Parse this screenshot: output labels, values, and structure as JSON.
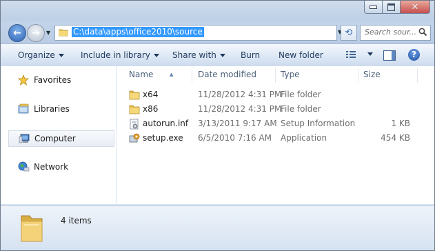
{
  "window": {
    "minimize_icon": "minimize-icon",
    "maximize_icon": "maximize-icon",
    "close_icon": "close-icon"
  },
  "address_bar": {
    "path": "C:\\data\\apps\\office2010\\source",
    "selected": true
  },
  "search": {
    "placeholder": "Search sour..."
  },
  "toolbar": {
    "organize": "Organize",
    "include_in_library": "Include in library",
    "share_with": "Share with",
    "burn": "Burn",
    "new_folder": "New folder"
  },
  "nav": {
    "favorites": "Favorites",
    "libraries": "Libraries",
    "computer": "Computer",
    "network": "Network"
  },
  "columns": {
    "name": "Name",
    "date_modified": "Date modified",
    "type": "Type",
    "size": "Size"
  },
  "files": [
    {
      "name": "x64",
      "date": "11/28/2012 4:31 PM",
      "type": "File folder",
      "size": "",
      "icon": "folder-icon"
    },
    {
      "name": "x86",
      "date": "11/28/2012 4:31 PM",
      "type": "File folder",
      "size": "",
      "icon": "folder-icon"
    },
    {
      "name": "autorun.inf",
      "date": "3/13/2011 9:17 AM",
      "type": "Setup Information",
      "size": "1 KB",
      "icon": "setup-info-icon"
    },
    {
      "name": "setup.exe",
      "date": "6/5/2010 7:16 AM",
      "type": "Application",
      "size": "454 KB",
      "icon": "setup-exe-icon"
    }
  ],
  "details": {
    "item_count": "4 items"
  },
  "colors": {
    "accent": "#3399ff",
    "chrome": "#dbe6f3",
    "link_text": "#1e395b"
  }
}
